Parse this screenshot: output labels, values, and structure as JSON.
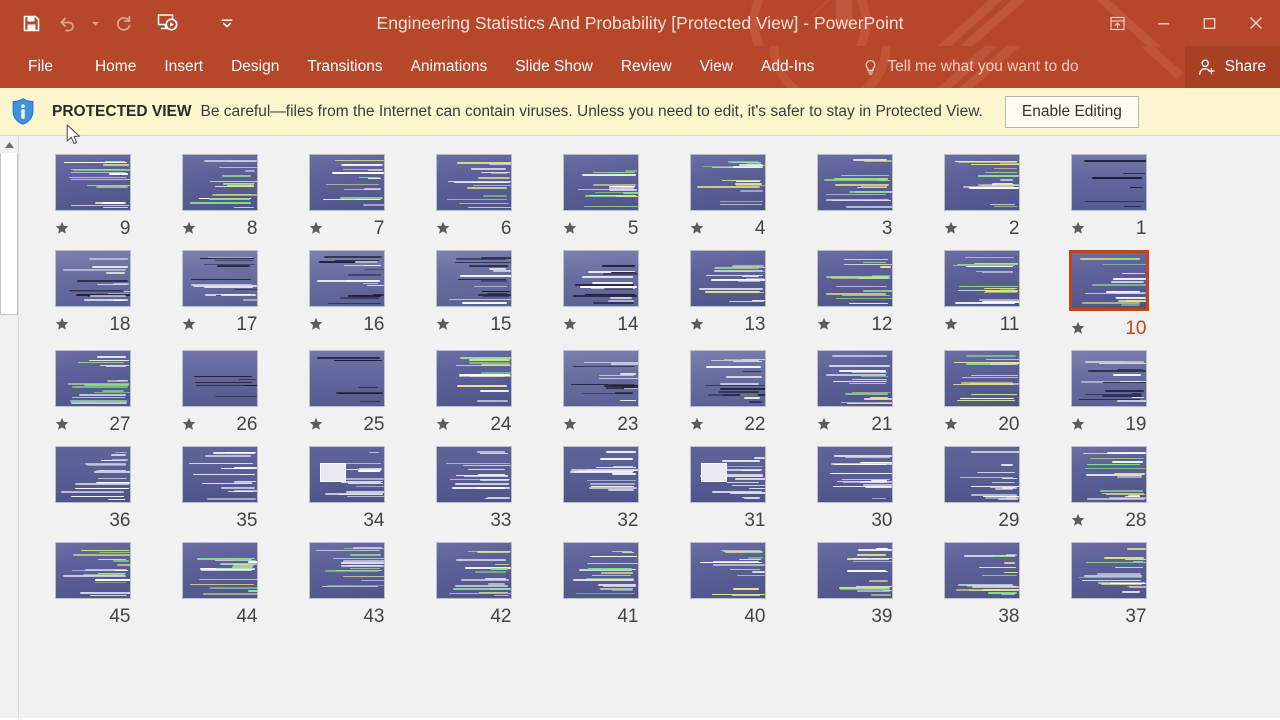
{
  "window": {
    "title": "Engineering Statistics And  Probability [Protected View] - PowerPoint",
    "accent_color": "#b7472a",
    "controls": {
      "ribbon_display_options": "ribbon-display-options-icon",
      "minimize": "minimize-icon",
      "restore": "restore-icon",
      "close": "close-icon"
    }
  },
  "quick_access_toolbar": {
    "items": [
      {
        "name": "save-button",
        "icon": "save-icon",
        "enabled": true
      },
      {
        "name": "undo-button",
        "icon": "undo-icon",
        "enabled": false
      },
      {
        "name": "undo-dropdown",
        "icon": "chevron-down-icon",
        "enabled": false
      },
      {
        "name": "redo-button",
        "icon": "redo-icon",
        "enabled": false
      },
      {
        "name": "start-presentation-button",
        "icon": "present-icon",
        "enabled": true
      },
      {
        "name": "customize-qat-button",
        "icon": "chevron-down-icon",
        "enabled": true
      }
    ]
  },
  "ribbon": {
    "tabs": [
      {
        "label": "File"
      },
      {
        "label": "Home"
      },
      {
        "label": "Insert"
      },
      {
        "label": "Design"
      },
      {
        "label": "Transitions"
      },
      {
        "label": "Animations"
      },
      {
        "label": "Slide Show"
      },
      {
        "label": "Review"
      },
      {
        "label": "View"
      },
      {
        "label": "Add-Ins"
      }
    ],
    "tell_me": "Tell me what you want to do",
    "tell_me_icon": "lightbulb-icon",
    "share_label": "Share",
    "share_icon": "person-add-icon"
  },
  "protected_view": {
    "icon": "info-shield-icon",
    "title": "PROTECTED VIEW",
    "message": "Be careful—files from the Internet can contain viruses. Unless you need to edit, it's safer to stay in Protected View.",
    "button_label": "Enable Editing",
    "background_color": "#fdf5ce"
  },
  "slide_sorter": {
    "selected_slide": 10,
    "selection_color": "#c0451f",
    "scrollbar": {
      "up_arrow_icon": "scroll-up-arrow-icon"
    },
    "rows": [
      {
        "slides": [
          {
            "number": "9",
            "animated": true,
            "style": 1
          },
          {
            "number": "8",
            "animated": true,
            "style": 1
          },
          {
            "number": "7",
            "animated": true,
            "style": 1
          },
          {
            "number": "6",
            "animated": true,
            "style": 1
          },
          {
            "number": "5",
            "animated": true,
            "style": 1
          },
          {
            "number": "4",
            "animated": true,
            "style": 1
          },
          {
            "number": "3",
            "animated": false,
            "style": 1
          },
          {
            "number": "2",
            "animated": true,
            "style": 1
          },
          {
            "number": "1",
            "animated": true,
            "style": 4
          }
        ]
      },
      {
        "slides": [
          {
            "number": "18",
            "animated": true,
            "style": 2
          },
          {
            "number": "17",
            "animated": true,
            "style": 2
          },
          {
            "number": "16",
            "animated": true,
            "style": 2
          },
          {
            "number": "15",
            "animated": true,
            "style": 2
          },
          {
            "number": "14",
            "animated": true,
            "style": 2
          },
          {
            "number": "13",
            "animated": true,
            "style": 1
          },
          {
            "number": "12",
            "animated": true,
            "style": 1
          },
          {
            "number": "11",
            "animated": true,
            "style": 1
          },
          {
            "number": "10",
            "animated": true,
            "style": 1,
            "selected": true
          }
        ]
      },
      {
        "slides": [
          {
            "number": "27",
            "animated": true,
            "style": 1
          },
          {
            "number": "26",
            "animated": true,
            "style": 4
          },
          {
            "number": "25",
            "animated": true,
            "style": 4
          },
          {
            "number": "24",
            "animated": true,
            "style": 1
          },
          {
            "number": "23",
            "animated": true,
            "style": 2
          },
          {
            "number": "22",
            "animated": true,
            "style": 2
          },
          {
            "number": "21",
            "animated": true,
            "style": 1
          },
          {
            "number": "20",
            "animated": true,
            "style": 1
          },
          {
            "number": "19",
            "animated": true,
            "style": 2
          }
        ]
      },
      {
        "slides": [
          {
            "number": "36",
            "animated": false,
            "style": 3
          },
          {
            "number": "35",
            "animated": false,
            "style": 3
          },
          {
            "number": "34",
            "animated": false,
            "style": 3
          },
          {
            "number": "33",
            "animated": false,
            "style": 3
          },
          {
            "number": "32",
            "animated": false,
            "style": 3
          },
          {
            "number": "31",
            "animated": false,
            "style": 3
          },
          {
            "number": "30",
            "animated": false,
            "style": 3
          },
          {
            "number": "29",
            "animated": false,
            "style": 3
          },
          {
            "number": "28",
            "animated": true,
            "style": 1
          }
        ]
      },
      {
        "partial": true,
        "slides": [
          {
            "number": "45",
            "animated": false,
            "style": 1
          },
          {
            "number": "44",
            "animated": false,
            "style": 1
          },
          {
            "number": "43",
            "animated": false,
            "style": 1
          },
          {
            "number": "42",
            "animated": false,
            "style": 1
          },
          {
            "number": "41",
            "animated": false,
            "style": 1
          },
          {
            "number": "40",
            "animated": false,
            "style": 1
          },
          {
            "number": "39",
            "animated": false,
            "style": 1
          },
          {
            "number": "38",
            "animated": false,
            "style": 1
          },
          {
            "number": "37",
            "animated": false,
            "style": 1
          }
        ]
      }
    ]
  }
}
